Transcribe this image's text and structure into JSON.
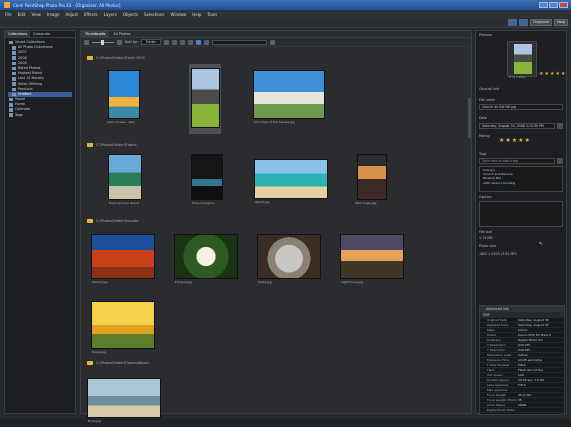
{
  "window": {
    "title": "Corel PaintShop Photo Pro X3 - [Organizer: All Photos]",
    "buttons": [
      "minimize",
      "maximize",
      "close"
    ]
  },
  "menu": [
    "File",
    "Edit",
    "View",
    "Image",
    "Adjust",
    "Effects",
    "Layers",
    "Objects",
    "Selections",
    "Window",
    "Help",
    "Tools"
  ],
  "toolbar_right": {
    "labels": [
      "",
      "",
      "Organize",
      "Help"
    ]
  },
  "left_panel": {
    "tabs": [
      "Collections",
      "Computer"
    ],
    "tree": [
      "Smart Collections",
      "All Photo Collections",
      "2007",
      "2008",
      "2009",
      "Rated Photos",
      "Highest Rated",
      "Last 12 Months",
      "Video Offering",
      "Products",
      "Untitled",
      "Travel",
      "Home",
      "Calendar",
      "Tags"
    ],
    "selected_index": 10,
    "colors": {
      "folder": "#7f95b8",
      "selection": "#3a5f9a"
    }
  },
  "center": {
    "tabs": [
      "Thumbnails",
      "All Photos"
    ],
    "toolbar": {
      "sort_label": "Sort by:",
      "sort_value": "Folder",
      "search_placeholder": ""
    },
    "groups": [
      {
        "label": "C:\\Photos\\Folder\\Travel 2009"
      },
      {
        "label": "C:\\Photos\\Folder\\Tropics"
      },
      {
        "label": "C:\\Photos\\Folder\\Sunsets"
      },
      {
        "label": "C:\\Photos\\Folder\\Flowers\\Beach"
      }
    ],
    "thumbs": [
      {
        "caption": "Lake houses - lake"
      },
      {
        "caption": ""
      },
      {
        "caption": "Churches of the Square.jpg"
      },
      {
        "caption": "Tropical Cove Island"
      },
      {
        "caption": "Tropical lagoon"
      },
      {
        "caption": "Island.jpg"
      },
      {
        "caption": "Palm trees.jpg"
      },
      {
        "caption": "Desert.jpg"
      },
      {
        "caption": "Flowers.jpg"
      },
      {
        "caption": "Koala.jpg"
      },
      {
        "caption": "Lighthouse.jpg"
      },
      {
        "caption": "Tulips.jpg"
      },
      {
        "caption": "Birds.jpg"
      }
    ]
  },
  "right_panel": {
    "preview_label": "Preview",
    "rating_caption": "3 of 5 stars",
    "sections": {
      "general": "General Info",
      "title": "File name",
      "title_value": "Church on the hill.jpg",
      "date": "Date",
      "date_value": "Saturday, August 30, 2008 3:15:30 PM",
      "rating": "Rating",
      "tags": "Tags",
      "tags_placeholder": "Type here to add a tag",
      "tag_list": [
        "Scenery",
        "Church architecture",
        "Blowing Mill",
        "19th century building"
      ],
      "caption": "Caption",
      "file_size_label": "File size",
      "file_size": "1.74 MB",
      "photo_size_label": "Photo size",
      "photo_size": "1602 x 2403 (3.85 MP)"
    },
    "rating_value": 5,
    "rating_max": 5,
    "metadata_head": "Advanced Info",
    "metadata_group": "EXIF",
    "metadata": [
      [
        "Original Date",
        "Saturday, August 30"
      ],
      [
        "Digitized Date",
        "Saturday, August 30"
      ],
      [
        "Make",
        "Canon"
      ],
      [
        "Model",
        "Canon EOS 5D Mark II"
      ],
      [
        "Software",
        "Digital Photo Pro"
      ],
      [
        "X Resolution",
        "240 DPI"
      ],
      [
        "Y Resolution",
        "240 DPI"
      ],
      [
        "Resolution Units",
        "Inches"
      ],
      [
        "Exposure Time",
        "1/125 second(s)"
      ],
      [
        "F-Stop Number",
        "F/8.0"
      ],
      [
        "Flash",
        "Flash did not fire"
      ],
      [
        "ISO Speed",
        "100"
      ],
      [
        "Shutter Speed",
        "1/125 sec. 7.0 EV"
      ],
      [
        "Lens Aperture",
        "F/8.0"
      ],
      [
        "Max Aperture",
        ""
      ],
      [
        "Focal Length",
        "35.0 mm"
      ],
      [
        "Focal Length 35mm",
        "35"
      ],
      [
        "Color Space",
        "sRGB"
      ],
      [
        "Digital Zoom Ratio",
        ""
      ],
      [
        "Exposure Bias",
        "0 EV (0.00)"
      ],
      [
        "Exposure Mode",
        "Auto"
      ],
      [
        "Exposure Program",
        "Aperture priority"
      ]
    ]
  }
}
